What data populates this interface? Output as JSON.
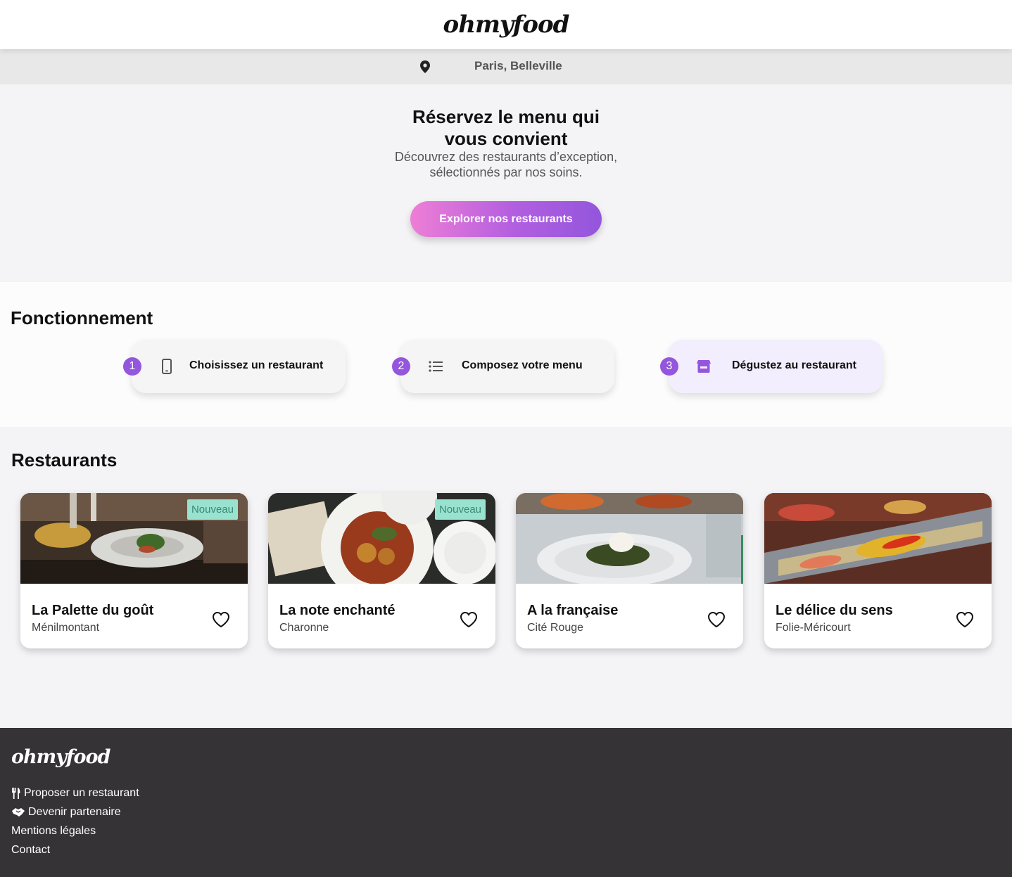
{
  "header": {
    "logo": "ohmyfood"
  },
  "location": {
    "text": "Paris, Belleville",
    "icon": "map-pin-icon"
  },
  "hero": {
    "title_line1": "Réservez le menu qui",
    "title_line2": "vous convient",
    "subtitle_line1": "Découvrez des restaurants d’exception,",
    "subtitle_line2": "sélectionnés par nos soins.",
    "cta_label": "Explorer nos restaurants"
  },
  "how": {
    "title": "Fonctionnement",
    "steps": [
      {
        "number": "1",
        "label": "Choisissez un restaurant",
        "icon": "mobile-phone-icon"
      },
      {
        "number": "2",
        "label": "Composez votre menu",
        "icon": "list-icon"
      },
      {
        "number": "3",
        "label": "Dégustez au restaurant",
        "icon": "store-icon"
      }
    ]
  },
  "restaurants": {
    "title": "Restaurants",
    "items": [
      {
        "name": "La Palette du goût",
        "location": "Ménilmontant",
        "badge": "Nouveau"
      },
      {
        "name": "La note enchanté",
        "location": "Charonne",
        "badge": "Nouveau"
      },
      {
        "name": "A la française",
        "location": "Cité Rouge",
        "badge": ""
      },
      {
        "name": "Le délice du sens",
        "location": "Folie-Méricourt",
        "badge": ""
      }
    ]
  },
  "footer": {
    "logo": "ohmyfood",
    "links": [
      {
        "label": "Proposer un restaurant",
        "icon": "utensils-icon"
      },
      {
        "label": "Devenir partenaire",
        "icon": "handshake-icon"
      },
      {
        "label": "Mentions légales",
        "icon": ""
      },
      {
        "label": "Contact",
        "icon": ""
      }
    ]
  },
  "colors": {
    "accent": "#9356dc",
    "gradient_start": "#ee7ed6",
    "badge_bg": "#99e2d0",
    "footer_bg": "#353336"
  }
}
